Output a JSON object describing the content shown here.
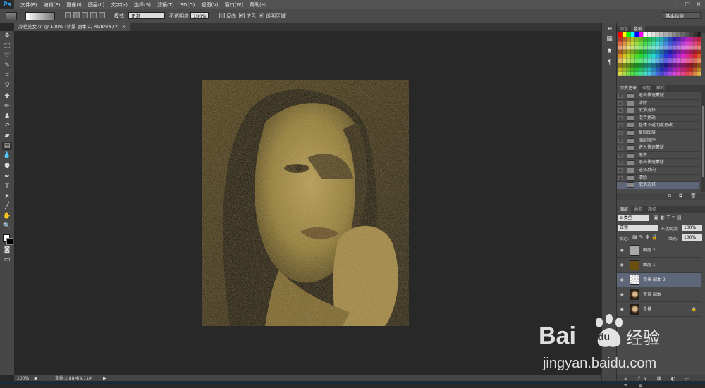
{
  "app": {
    "logo": "Ps"
  },
  "menu": [
    "文件(F)",
    "编辑(E)",
    "图像(I)",
    "图层(L)",
    "文字(Y)",
    "选择(S)",
    "滤镜(T)",
    "3D(D)",
    "视图(V)",
    "窗口(W)",
    "帮助(H)"
  ],
  "window_controls": [
    "–",
    "□",
    "×"
  ],
  "options": {
    "mode_label": "模式:",
    "mode_value": "正常",
    "opacity_label": "不透明度:",
    "opacity_value": "100%",
    "reverse_label": "反向",
    "dither_label": "仿色",
    "transparency_label": "透明区域",
    "workspace": "基本功能",
    "dither_checked": true,
    "transparency_checked": true
  },
  "document": {
    "tab_title": "冷艳美女.tif @ 100% (背景 副本 2, RGB/8#) *",
    "tab_close": "×"
  },
  "status": {
    "zoom": "100%",
    "doc_info": "文档:1.88M/4.11M"
  },
  "swatch_panel": {
    "tabs": [
      "颜色",
      "色板"
    ],
    "active": 1
  },
  "history_panel": {
    "tabs": [
      "历史记录",
      "调整",
      "样式"
    ],
    "items": [
      "退出快速蒙版",
      "清除",
      "取消选择",
      "混合更改",
      "整体不透明度更改",
      "复制图层",
      "图层顺序",
      "进入快速蒙版",
      "渐变",
      "退出快速蒙版",
      "选择反向",
      "清除",
      "取消选择"
    ],
    "selected_index": 12
  },
  "layers_panel": {
    "tabs": [
      "图层",
      "通道",
      "路径"
    ],
    "filter_label": "ρ 类型",
    "blend_mode": "正常",
    "opacity_label": "不透明度:",
    "opacity_value": "100%",
    "lock_label": "锁定:",
    "fill_label": "填充:",
    "fill_value": "100%",
    "layers": [
      {
        "name": "图层 2",
        "thumb": "#a8a8a8"
      },
      {
        "name": "图层 1",
        "thumb": "#6b4f10"
      },
      {
        "name": "背景 副本 2",
        "thumb": "checker"
      },
      {
        "name": "背景 副本",
        "thumb": "portrait"
      },
      {
        "name": "背景",
        "thumb": "portrait"
      }
    ],
    "selected_index": 2
  },
  "watermark": {
    "brand": "Bai",
    "brand2": "du",
    "jingyan": "经验",
    "url": "jingyan.baidu.com"
  },
  "colors": {
    "accent_selected": "#5d6779",
    "photo_tint": "#8a7430"
  }
}
